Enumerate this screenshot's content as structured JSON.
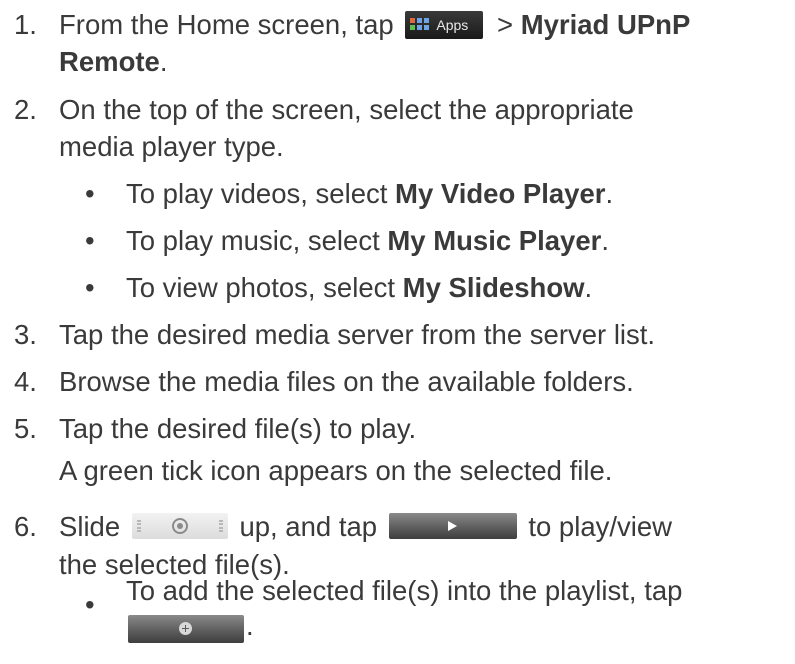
{
  "steps": {
    "s1": {
      "num": "1.",
      "pre": "From the Home screen, tap",
      "apps_icon_label": "Apps",
      "sep": ">",
      "bold": "Myriad UPnP",
      "bold_cont": "Remote",
      "post": "."
    },
    "s2": {
      "num": "2.",
      "line1": "On the top of the screen, select the appropriate",
      "line2": "media player type.",
      "bullets": [
        {
          "pre": "To play videos, select ",
          "bold": "My Video Player",
          "post": "."
        },
        {
          "pre": "To play music, select ",
          "bold": "My Music Player",
          "post": "."
        },
        {
          "pre": "To view photos, select ",
          "bold": "My Slideshow",
          "post": "."
        }
      ]
    },
    "s3": {
      "num": "3.",
      "text": "Tap the desired media server from the server list."
    },
    "s4": {
      "num": "4.",
      "text": "Browse the media files on the available folders."
    },
    "s5": {
      "num": "5.",
      "text": "Tap the desired file(s) to play.",
      "note": "A green tick icon appears on the selected file."
    },
    "s6": {
      "num": "6.",
      "pre": "Slide",
      "mid": "up, and tap",
      "post": "to play/view",
      "line2": "the selected file(s).",
      "bullet": "To add the selected file(s) into the playlist, tap",
      "bullet_end": "."
    }
  },
  "bullet_char": "•",
  "icons": {
    "apps": "apps-grid-icon",
    "slider": "drag-handle-slider-icon",
    "play": "play-icon",
    "add": "add-to-playlist-icon"
  },
  "colors": {
    "text": "#3a3a3a",
    "button_dark": "#3e3e3e",
    "apps_bg": "#1a1a1a"
  }
}
